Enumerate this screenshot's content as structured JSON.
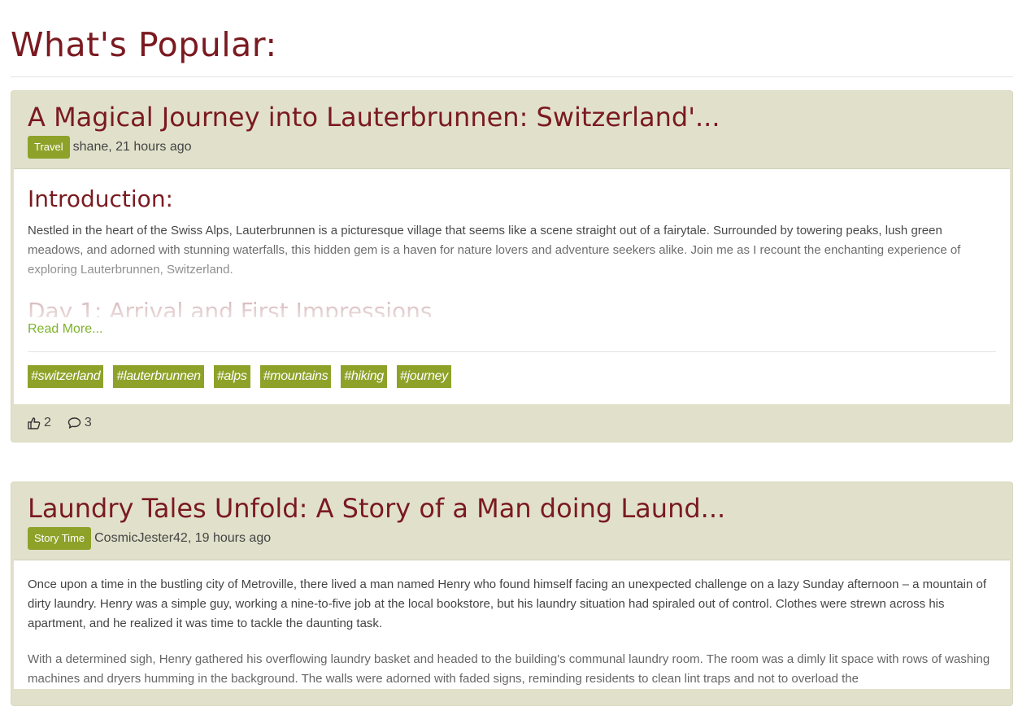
{
  "page": {
    "title": "What's Popular:"
  },
  "posts": [
    {
      "title": "A Magical Journey into Lauterbrunnen: Switzerland'...",
      "category": "Travel",
      "author_time": "shane, 21 hours ago",
      "excerpt_heading": "Introduction:",
      "excerpt_text": "Nestled in the heart of the Swiss Alps, Lauterbrunnen is a picturesque village that seems like a scene straight out of a fairytale. Surrounded by towering peaks, lush green meadows, and adorned with stunning waterfalls, this hidden gem is a haven for nature lovers and adventure seekers alike. Join me as I recount the enchanting experience of exploring Lauterbrunnen, Switzerland.",
      "excerpt_subheading": "Day 1: Arrival and First Impressions",
      "read_more": "Read More...",
      "tags": [
        "#switzerland",
        "#lauterbrunnen",
        "#alps",
        "#mountains",
        "#hiking",
        "#journey"
      ],
      "likes": "2",
      "comments": "3"
    },
    {
      "title": "Laundry Tales Unfold: A Story of a Man doing Laund...",
      "category": "Story Time",
      "author_time": "CosmicJester42, 19 hours ago",
      "paragraph_1": "Once upon a time in the bustling city of Metroville, there lived a man named Henry who found himself facing an unexpected challenge on a lazy Sunday afternoon – a mountain of dirty laundry. Henry was a simple guy, working a nine-to-five job at the local bookstore, but his laundry situation had spiraled out of control. Clothes were strewn across his apartment, and he realized it was time to tackle the daunting task.",
      "paragraph_2": "With a determined sigh, Henry gathered his overflowing laundry basket and headed to the building's communal laundry room. The room was a dimly lit space with rows of washing machines and dryers humming in the background. The walls were adorned with faded signs, reminding residents to clean lint traps and not to overload the"
    }
  ],
  "icons": {
    "like": "thumbs-up-icon",
    "comment": "comment-icon"
  },
  "colors": {
    "title": "#7a1a20",
    "badge": "#8ea22a",
    "card_bg": "#e1e1cb",
    "link": "#7db32a"
  }
}
